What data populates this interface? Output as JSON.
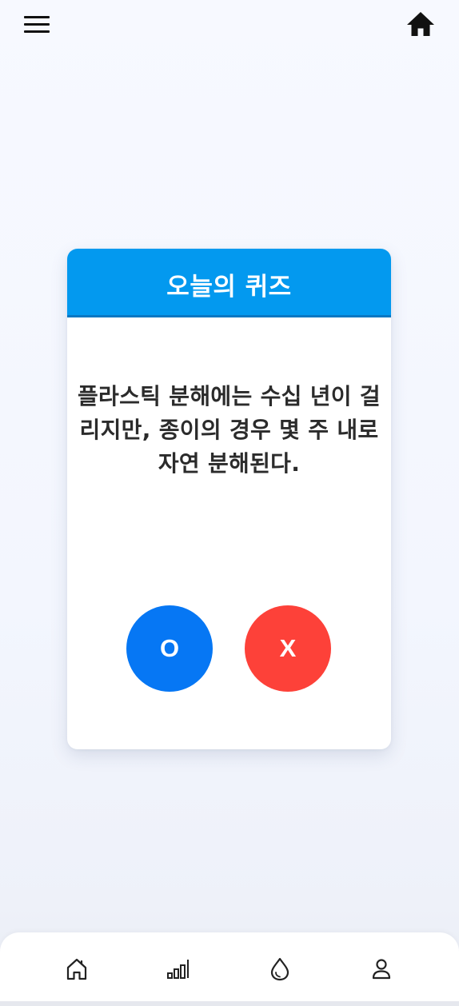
{
  "header": {
    "menu_icon": "hamburger-menu-icon",
    "home_icon": "home-icon"
  },
  "quiz": {
    "title": "오늘의 퀴즈",
    "question": "플라스틱 분해에는 수십 년이 걸리지만, 종이의 경우 몇 주 내로 자연 분해된다.",
    "answers": {
      "o_label": "O",
      "x_label": "X"
    }
  },
  "bottom_nav": {
    "items": [
      {
        "icon": "home-outline-icon"
      },
      {
        "icon": "bar-chart-icon"
      },
      {
        "icon": "water-drop-icon"
      },
      {
        "icon": "user-icon"
      }
    ]
  },
  "colors": {
    "header_blue": "#0399ef",
    "o_button": "#0677f4",
    "x_button": "#fd4139",
    "text_dark": "#2b2b2b"
  }
}
